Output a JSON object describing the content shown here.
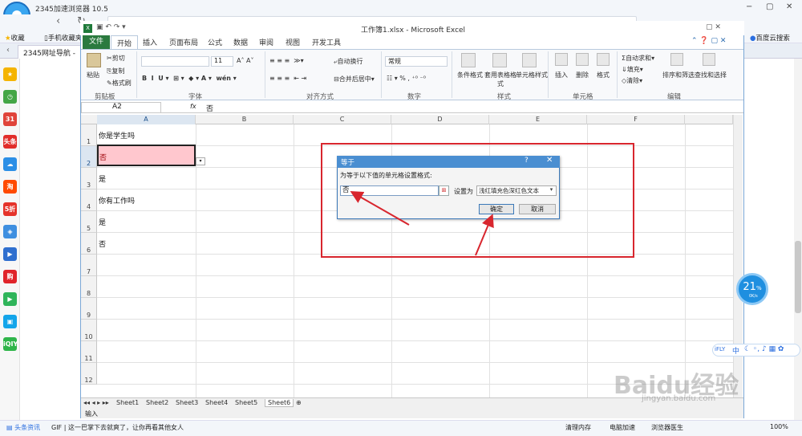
{
  "browser": {
    "title": "2345加速浏览器 10.5",
    "bookmarks": [
      "收藏",
      "手机收藏夹"
    ],
    "tab": "2345网址导航 -",
    "right_links": [
      "百度云搜索"
    ],
    "window_controls": [
      "−",
      "▢",
      "✕"
    ]
  },
  "sidebar_icons": [
    {
      "name": "star-icon",
      "color": "#f5b400",
      "glyph": "★"
    },
    {
      "name": "clock-icon",
      "color": "#45a646",
      "glyph": "◷"
    },
    {
      "name": "calendar-icon",
      "color": "#e0443a",
      "glyph": "31"
    },
    {
      "name": "toutiao-icon",
      "color": "#e12d2a",
      "glyph": "头条"
    },
    {
      "name": "cloud-icon",
      "color": "#2c8fe6",
      "glyph": "☁"
    },
    {
      "name": "taobao-icon",
      "color": "#ff4a00",
      "glyph": "淘"
    },
    {
      "name": "gift-icon",
      "color": "#e5332a",
      "glyph": "5折"
    },
    {
      "name": "gamepad-icon",
      "color": "#3f8fe0",
      "glyph": "◈"
    },
    {
      "name": "video-icon",
      "color": "#2f6fcf",
      "glyph": "▶"
    },
    {
      "name": "shopping-icon",
      "color": "#e0242a",
      "glyph": "购"
    },
    {
      "name": "play-icon",
      "color": "#2fb45a",
      "glyph": "▶"
    },
    {
      "name": "tv-icon",
      "color": "#14a5ea",
      "glyph": "▣"
    },
    {
      "name": "iqiyi-icon",
      "color": "#2fb54a",
      "glyph": "iQIY"
    }
  ],
  "excel": {
    "title": "工作簿1.xlsx - Microsoft Excel",
    "tabs": [
      "文件",
      "开始",
      "插入",
      "页面布局",
      "公式",
      "数据",
      "审阅",
      "视图",
      "开发工具"
    ],
    "ribbon": {
      "clipboard": {
        "paste": "粘贴",
        "cut": "剪切",
        "copy": "复制",
        "format_painter": "格式刷",
        "label": "剪贴板"
      },
      "font": {
        "size": "11",
        "label": "字体"
      },
      "alignment": {
        "wrap": "自动换行",
        "merge": "合并后居中",
        "label": "对齐方式"
      },
      "number": {
        "format": "常规",
        "label": "数字"
      },
      "styles": {
        "cond": "条件格式",
        "table": "套用表格格式",
        "cell": "单元格样式",
        "label": "样式"
      },
      "cells": {
        "insert": "插入",
        "delete": "删除",
        "format": "格式",
        "label": "单元格"
      },
      "editing": {
        "autosum": "自动求和",
        "fill": "填充",
        "clear": "清除",
        "sort": "排序和筛选",
        "find": "查找和选择",
        "label": "编辑"
      }
    },
    "namebox": "A2",
    "fx": "fx",
    "formula": "否",
    "columns": [
      "A",
      "B",
      "C",
      "D",
      "E",
      "F"
    ],
    "rows": [
      "1",
      "2",
      "3",
      "4",
      "5",
      "6",
      "7",
      "8",
      "9",
      "10",
      "11",
      "12"
    ],
    "cells": {
      "a1": "你是学生吗",
      "a2": "否",
      "a3": "是",
      "a4": "你有工作吗",
      "a5": "是",
      "a6": "否"
    },
    "sheets": [
      "Sheet1",
      "Sheet2",
      "Sheet3",
      "Sheet4",
      "Sheet5",
      "Sheet6"
    ],
    "status": "输入"
  },
  "dialog": {
    "title": "等于",
    "help": "?",
    "close": "✕",
    "prompt": "为等于以下值的单元格设置格式:",
    "value": "否",
    "set_as_label": "设置为",
    "set_as_value": "浅红填充色深红色文本",
    "ok": "确定",
    "cancel": "取消"
  },
  "meter": {
    "value": "21",
    "unit": "%",
    "speed": "0K/s"
  },
  "ime": {
    "brand": "iFLY",
    "mode": "中"
  },
  "taskbar": {
    "news": "头条资讯",
    "headline": "GIF | 这一巴掌下去就爽了，让你再看其他女人",
    "items": [
      "清理内存",
      "电脑加速",
      "浏览器医生"
    ],
    "zoom": "100%"
  },
  "watermark": {
    "brand": "Baidu经验",
    "url": "jingyan.baidu.com"
  },
  "accent_color": "#d8262e"
}
